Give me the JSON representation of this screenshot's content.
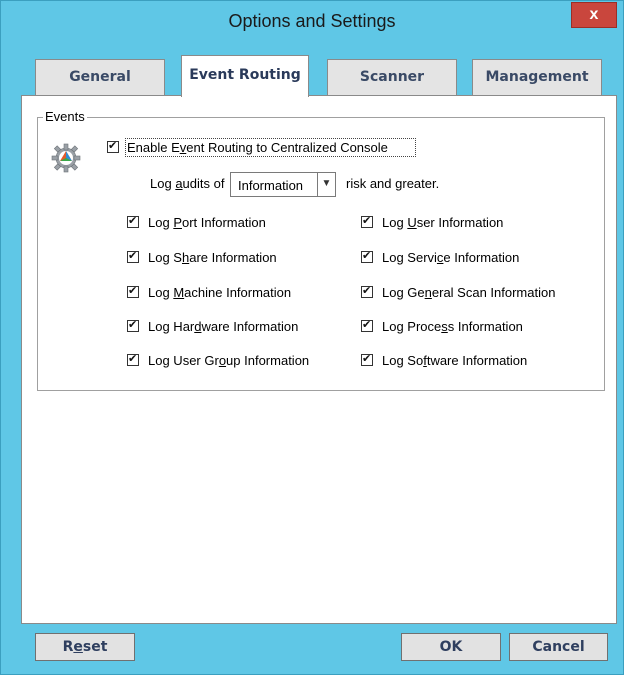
{
  "window": {
    "title": "Options and Settings",
    "close_label": "x"
  },
  "tabs": [
    {
      "label": "General",
      "active": false
    },
    {
      "label": "Event Routing",
      "active": true
    },
    {
      "label": "Scanner",
      "active": false
    },
    {
      "label": "Management",
      "active": false
    }
  ],
  "events": {
    "group_label": "Events",
    "enable": {
      "checked": true,
      "label_pre": "Enable E",
      "label_ul": "v",
      "label_post": "ent Routing to Centralized Console"
    },
    "log_audits": {
      "prefix_pre": "Log ",
      "prefix_ul": "a",
      "prefix_post": "udits of",
      "selected": "Information",
      "suffix": "risk and greater."
    },
    "left_options": [
      {
        "pre": "Log ",
        "ul": "P",
        "post": "ort Information",
        "checked": true
      },
      {
        "pre": "Log S",
        "ul": "h",
        "post": "are Information",
        "checked": true
      },
      {
        "pre": "Log ",
        "ul": "M",
        "post": "achine Information",
        "checked": true
      },
      {
        "pre": "Log Har",
        "ul": "d",
        "post": "ware Information",
        "checked": true
      },
      {
        "pre": "Log User Gr",
        "ul": "o",
        "post": "up Information",
        "checked": true
      }
    ],
    "right_options": [
      {
        "pre": "Log ",
        "ul": "U",
        "post": "ser Information",
        "checked": true
      },
      {
        "pre": "Log Servi",
        "ul": "c",
        "post": "e Information",
        "checked": true
      },
      {
        "pre": "Log Ge",
        "ul": "n",
        "post": "eral Scan Information",
        "checked": true
      },
      {
        "pre": "Log Proce",
        "ul": "s",
        "post": "s Information",
        "checked": true
      },
      {
        "pre": "Log So",
        "ul": "f",
        "post": "tware Information",
        "checked": true
      }
    ]
  },
  "buttons": {
    "reset_pre": "R",
    "reset_ul": "e",
    "reset_post": "set",
    "ok": "OK",
    "cancel": "Cancel"
  }
}
